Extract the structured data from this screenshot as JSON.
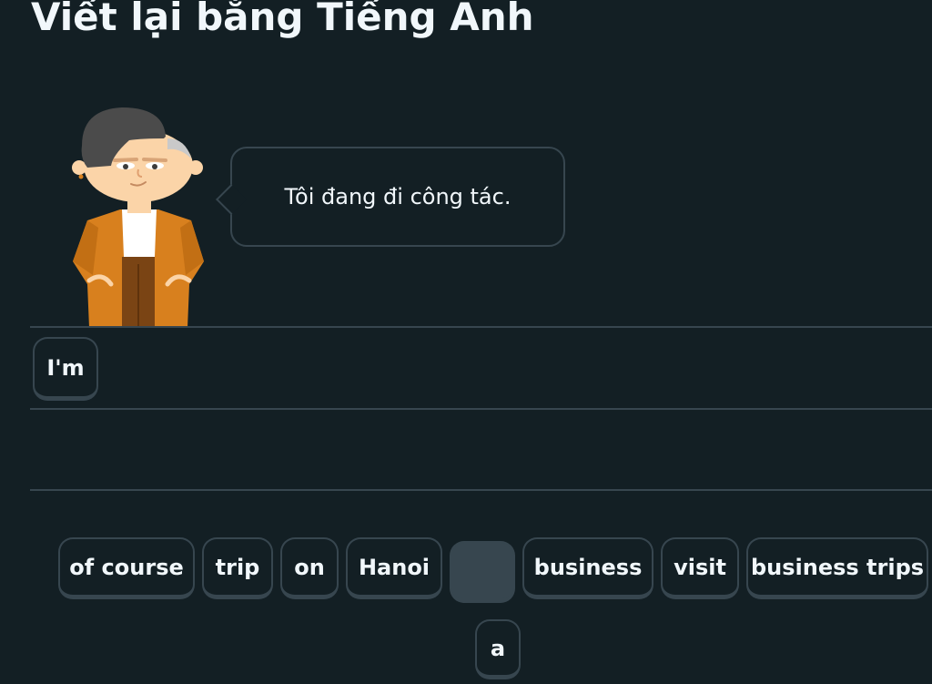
{
  "header": {
    "title": "Viết lại bằng Tiếng Anh"
  },
  "prompt": {
    "character": "character-illustration",
    "speech": "Tôi đang đi công tác."
  },
  "answer": {
    "placed_words": [
      "I'm"
    ]
  },
  "word_bank": {
    "words": [
      "of course",
      "trip",
      "on",
      "Hanoi",
      "",
      "business",
      "visit",
      "business trips",
      "a"
    ]
  },
  "colors": {
    "background": "#131f24",
    "border": "#37464f",
    "text": "#f1f7fb",
    "character_jacket": "#d8801e",
    "character_skin": "#fbd4a8",
    "character_hair": "#4b4b4b"
  }
}
